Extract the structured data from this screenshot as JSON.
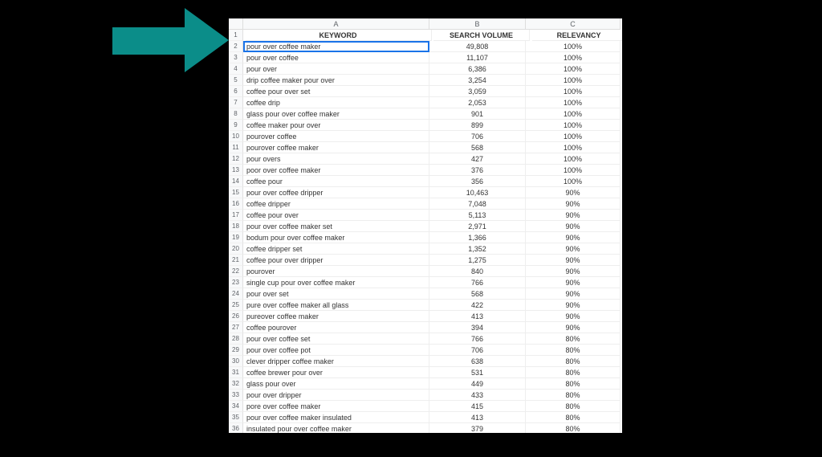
{
  "columns": {
    "A": "A",
    "B": "B",
    "C": "C"
  },
  "header": {
    "keyword": "KEYWORD",
    "volume": "SEARCH VOLUME",
    "relevancy": "RELEVANCY"
  },
  "selected_row": 2,
  "rows": [
    {
      "n": 2,
      "keyword": "pour over coffee maker",
      "volume": "49,808",
      "relevancy": "100%"
    },
    {
      "n": 3,
      "keyword": "pour over coffee",
      "volume": "11,107",
      "relevancy": "100%"
    },
    {
      "n": 4,
      "keyword": "pour over",
      "volume": "6,386",
      "relevancy": "100%"
    },
    {
      "n": 5,
      "keyword": "drip coffee maker pour over",
      "volume": "3,254",
      "relevancy": "100%"
    },
    {
      "n": 6,
      "keyword": "coffee pour over set",
      "volume": "3,059",
      "relevancy": "100%"
    },
    {
      "n": 7,
      "keyword": "coffee drip",
      "volume": "2,053",
      "relevancy": "100%"
    },
    {
      "n": 8,
      "keyword": "glass pour over coffee maker",
      "volume": "901",
      "relevancy": "100%"
    },
    {
      "n": 9,
      "keyword": "coffee maker pour over",
      "volume": "899",
      "relevancy": "100%"
    },
    {
      "n": 10,
      "keyword": "pourover coffee",
      "volume": "706",
      "relevancy": "100%"
    },
    {
      "n": 11,
      "keyword": "pourover coffee maker",
      "volume": "568",
      "relevancy": "100%"
    },
    {
      "n": 12,
      "keyword": "pour overs",
      "volume": "427",
      "relevancy": "100%"
    },
    {
      "n": 13,
      "keyword": "poor over coffee maker",
      "volume": "376",
      "relevancy": "100%"
    },
    {
      "n": 14,
      "keyword": "coffee pour",
      "volume": "356",
      "relevancy": "100%"
    },
    {
      "n": 15,
      "keyword": "pour over coffee dripper",
      "volume": "10,463",
      "relevancy": "90%"
    },
    {
      "n": 16,
      "keyword": "coffee dripper",
      "volume": "7,048",
      "relevancy": "90%"
    },
    {
      "n": 17,
      "keyword": "coffee pour over",
      "volume": "5,113",
      "relevancy": "90%"
    },
    {
      "n": 18,
      "keyword": "pour over coffee maker set",
      "volume": "2,971",
      "relevancy": "90%"
    },
    {
      "n": 19,
      "keyword": "bodum pour over coffee maker",
      "volume": "1,366",
      "relevancy": "90%"
    },
    {
      "n": 20,
      "keyword": "coffee dripper set",
      "volume": "1,352",
      "relevancy": "90%"
    },
    {
      "n": 21,
      "keyword": "coffee pour over dripper",
      "volume": "1,275",
      "relevancy": "90%"
    },
    {
      "n": 22,
      "keyword": "pourover",
      "volume": "840",
      "relevancy": "90%"
    },
    {
      "n": 23,
      "keyword": "single cup pour over coffee maker",
      "volume": "766",
      "relevancy": "90%"
    },
    {
      "n": 24,
      "keyword": "pour over set",
      "volume": "568",
      "relevancy": "90%"
    },
    {
      "n": 25,
      "keyword": "pure over coffee maker all glass",
      "volume": "422",
      "relevancy": "90%"
    },
    {
      "n": 26,
      "keyword": "pureover coffee maker",
      "volume": "413",
      "relevancy": "90%"
    },
    {
      "n": 27,
      "keyword": "coffee pourover",
      "volume": "394",
      "relevancy": "90%"
    },
    {
      "n": 28,
      "keyword": "pour over coffee set",
      "volume": "766",
      "relevancy": "80%"
    },
    {
      "n": 29,
      "keyword": "pour over coffee pot",
      "volume": "706",
      "relevancy": "80%"
    },
    {
      "n": 30,
      "keyword": "clever dripper coffee maker",
      "volume": "638",
      "relevancy": "80%"
    },
    {
      "n": 31,
      "keyword": "coffee brewer pour over",
      "volume": "531",
      "relevancy": "80%"
    },
    {
      "n": 32,
      "keyword": "glass pour over",
      "volume": "449",
      "relevancy": "80%"
    },
    {
      "n": 33,
      "keyword": "pour over dripper",
      "volume": "433",
      "relevancy": "80%"
    },
    {
      "n": 34,
      "keyword": "pore over coffee maker",
      "volume": "415",
      "relevancy": "80%"
    },
    {
      "n": 35,
      "keyword": "pour over coffee maker insulated",
      "volume": "413",
      "relevancy": "80%"
    },
    {
      "n": 36,
      "keyword": "insulated pour over coffee maker",
      "volume": "379",
      "relevancy": "80%"
    }
  ]
}
